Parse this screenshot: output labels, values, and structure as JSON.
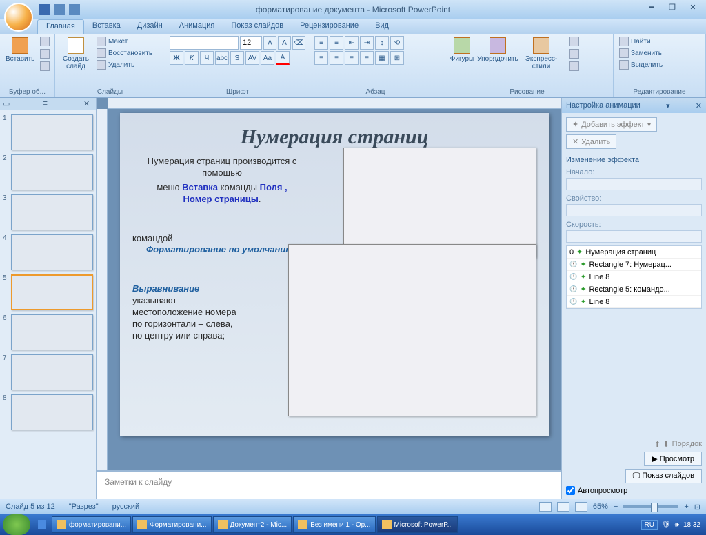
{
  "title": "форматирование документа - Microsoft PowerPoint",
  "tabs": {
    "home": "Главная",
    "insert": "Вставка",
    "design": "Дизайн",
    "anim": "Анимация",
    "show": "Показ слайдов",
    "review": "Рецензирование",
    "view": "Вид"
  },
  "ribbon": {
    "clipboard": {
      "label": "Буфер об...",
      "paste": "Вставить"
    },
    "slides": {
      "label": "Слайды",
      "new": "Создать\nслайд",
      "layout": "Макет",
      "reset": "Восстановить",
      "delete": "Удалить"
    },
    "font": {
      "label": "Шрифт",
      "size": "12"
    },
    "para": {
      "label": "Абзац"
    },
    "draw": {
      "label": "Рисование",
      "shapes": "Фигуры",
      "arrange": "Упорядочить",
      "styles": "Экспресс-стили"
    },
    "edit": {
      "label": "Редактирование",
      "find": "Найти",
      "replace": "Заменить",
      "select": "Выделить"
    }
  },
  "thumbs": [
    "1",
    "2",
    "3",
    "4",
    "5",
    "6",
    "7",
    "8"
  ],
  "slide": {
    "title": "Нумерация страниц",
    "p1": "Нумерация страниц производится с помощью",
    "p2a": "меню ",
    "p2b": "Вставка",
    "p2c": " команды ",
    "p2d": "Поля ,",
    "p2e": "Номер страницы",
    "p3a": "командой",
    "p3b": "Форматирование по умолчанию ,",
    "p4a": "Выравнивание",
    "p4b": "указывают местоположение номера по горизонтали – слева, по центру или справа;"
  },
  "notes": "Заметки к слайду",
  "anim": {
    "title": "Настройка анимации",
    "add": "Добавить эффект",
    "del": "Удалить",
    "change": "Изменение эффекта",
    "start": "Начало:",
    "prop": "Свойство:",
    "speed": "Скорость:",
    "items": [
      "Нумерация страниц",
      "Rectangle 7: Нумерац...",
      "Line 8",
      "Rectangle 5:  командо...",
      "Line 8"
    ],
    "order": "Порядок",
    "preview": "Просмотр",
    "show": "Показ слайдов",
    "auto": "Автопросмотр"
  },
  "status": {
    "slide": "Слайд 5 из 12",
    "theme": "\"Разрез\"",
    "lang": "русский",
    "zoom": "65%"
  },
  "taskbar": {
    "items": [
      "форматировани...",
      "Форматировани...",
      "Документ2 - Mic...",
      "Без имени 1 - Op...",
      "Microsoft PowerP..."
    ],
    "lang": "RU",
    "time": "18:32"
  }
}
